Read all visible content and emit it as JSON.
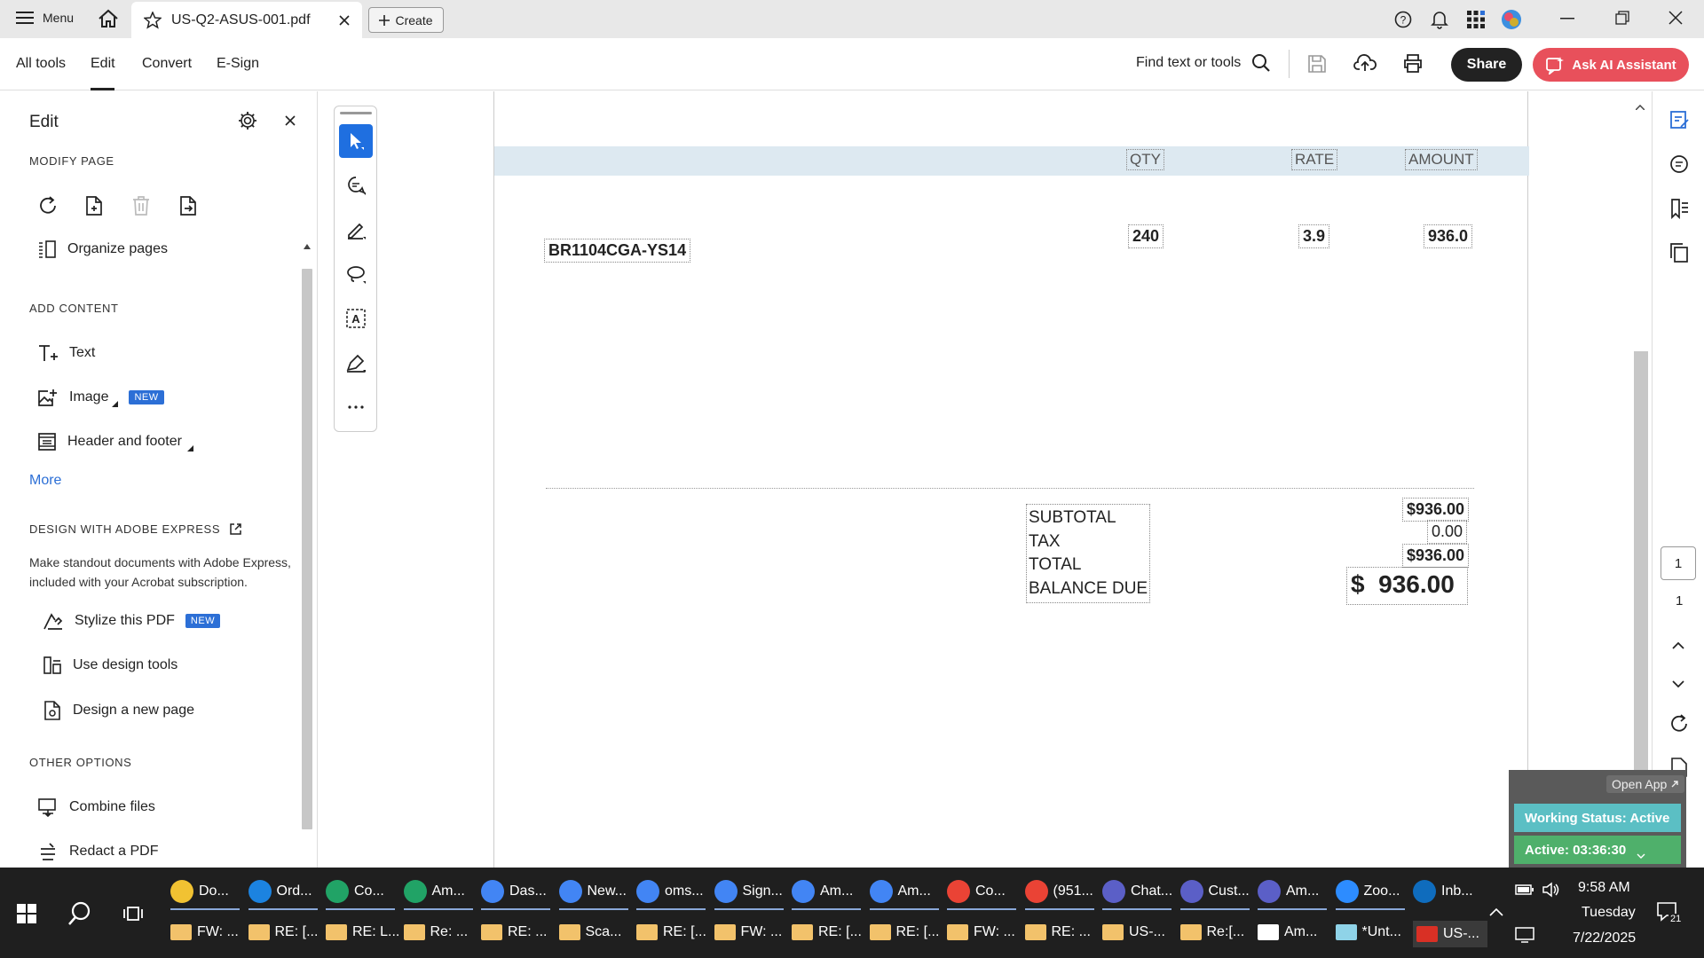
{
  "titlebar": {
    "menu_label": "Menu",
    "tab_title": "US-Q2-ASUS-001.pdf",
    "create_label": "Create"
  },
  "toolbar": {
    "tabs": [
      "All tools",
      "Edit",
      "Convert",
      "E-Sign"
    ],
    "active_tab": "Edit",
    "find_label": "Find text or tools",
    "share_label": "Share",
    "ai_label": "Ask AI Assistant"
  },
  "panel": {
    "title": "Edit",
    "modify_head": "MODIFY PAGE",
    "organize_label": "Organize pages",
    "add_head": "ADD CONTENT",
    "text_label": "Text",
    "image_label": "Image",
    "new_badge": "NEW",
    "header_footer_label": "Header and footer",
    "more_label": "More",
    "design_head": "DESIGN WITH ADOBE EXPRESS",
    "design_desc": "Make standout documents with Adobe Express, included with your Acrobat subscription.",
    "stylize_label": "Stylize this PDF",
    "design_tools_label": "Use design tools",
    "design_page_label": "Design a new page",
    "other_head": "OTHER OPTIONS",
    "combine_label": "Combine files",
    "redact_label": "Redact a PDF"
  },
  "doc": {
    "col_qty": "QTY",
    "col_rate": "RATE",
    "col_amount": "AMOUNT",
    "item_code": "BR1104CGA-YS14",
    "qty": "240",
    "rate": "3.9",
    "amount": "936.0",
    "labels": [
      "SUBTOTAL",
      "TAX",
      "TOTAL",
      "BALANCE DUE"
    ],
    "subtotal": "$936.00",
    "tax": "0.00",
    "total": "$936.00",
    "balance_due": "$  936.00"
  },
  "rightrail": {
    "page_input": "1",
    "page_total": "1"
  },
  "status": {
    "open_app": "Open App",
    "working": "Working Status: Active",
    "active_time": "Active: 03:36:30"
  },
  "taskbar": {
    "row1": [
      "Do...",
      "Ord...",
      "Co...",
      "Am...",
      "Das...",
      "New...",
      "oms...",
      "Sign...",
      "Am...",
      "Am...",
      "Co...",
      "(951...",
      "Chat...",
      "Cust...",
      "Am...",
      "Zoo...",
      "Inb..."
    ],
    "row2": [
      "FW: ...",
      "RE: [...",
      "RE: L...",
      "Re: ...",
      "RE: ...",
      "Sca...",
      "RE: [...",
      "FW: ...",
      "RE: [...",
      "RE: [...",
      "FW: ...",
      "RE: ...",
      "US-...",
      "Re:[...",
      "Am...",
      "*Unt...",
      "US-..."
    ],
    "time": "9:58 AM",
    "day": "Tuesday",
    "date": "7/22/2025",
    "notif_count": "21"
  },
  "colors": {
    "accent_ai": "#e8505b",
    "badge_blue": "#2c6fd6",
    "header_band": "#dde9f1",
    "status_green": "#4fb06b",
    "status_teal": "#5bbfc4"
  }
}
